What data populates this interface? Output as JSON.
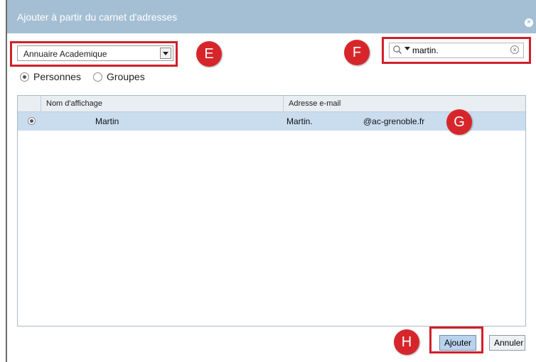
{
  "dialog": {
    "title": "Ajouter à partir du carnet d'adresses",
    "close_label": "×"
  },
  "directory_select": {
    "selected": "Annuaire Academique"
  },
  "search": {
    "value": "martin."
  },
  "radio": {
    "persons": "Personnes",
    "groups": "Groupes",
    "selected": "Personnes"
  },
  "table": {
    "columns": [
      "Nom d'affichage",
      "Adresse e-mail"
    ],
    "rows": [
      {
        "name": "Martin",
        "email_user": "Martin.",
        "email_domain": "@ac-grenoble.fr",
        "selected": true
      }
    ]
  },
  "buttons": {
    "add": "Ajouter",
    "cancel": "Annuler"
  },
  "annotations": {
    "e": "E",
    "f": "F",
    "g": "G",
    "h": "H"
  },
  "colors": {
    "titlebar": "#a4bfd4",
    "highlight": "#d0202a",
    "badge": "#d7262b",
    "selected_row": "#c9ddef"
  }
}
